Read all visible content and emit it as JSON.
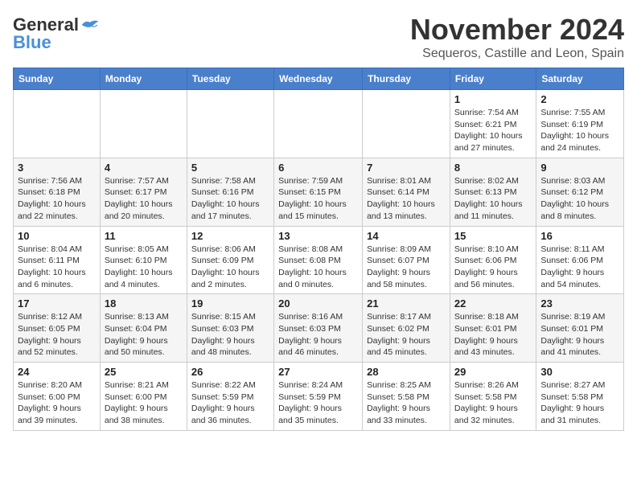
{
  "logo": {
    "general": "General",
    "blue": "Blue"
  },
  "title": "November 2024",
  "subtitle": "Sequeros, Castille and Leon, Spain",
  "days_of_week": [
    "Sunday",
    "Monday",
    "Tuesday",
    "Wednesday",
    "Thursday",
    "Friday",
    "Saturday"
  ],
  "weeks": [
    [
      {
        "day": "",
        "info": ""
      },
      {
        "day": "",
        "info": ""
      },
      {
        "day": "",
        "info": ""
      },
      {
        "day": "",
        "info": ""
      },
      {
        "day": "",
        "info": ""
      },
      {
        "day": "1",
        "info": "Sunrise: 7:54 AM\nSunset: 6:21 PM\nDaylight: 10 hours and 27 minutes."
      },
      {
        "day": "2",
        "info": "Sunrise: 7:55 AM\nSunset: 6:19 PM\nDaylight: 10 hours and 24 minutes."
      }
    ],
    [
      {
        "day": "3",
        "info": "Sunrise: 7:56 AM\nSunset: 6:18 PM\nDaylight: 10 hours and 22 minutes."
      },
      {
        "day": "4",
        "info": "Sunrise: 7:57 AM\nSunset: 6:17 PM\nDaylight: 10 hours and 20 minutes."
      },
      {
        "day": "5",
        "info": "Sunrise: 7:58 AM\nSunset: 6:16 PM\nDaylight: 10 hours and 17 minutes."
      },
      {
        "day": "6",
        "info": "Sunrise: 7:59 AM\nSunset: 6:15 PM\nDaylight: 10 hours and 15 minutes."
      },
      {
        "day": "7",
        "info": "Sunrise: 8:01 AM\nSunset: 6:14 PM\nDaylight: 10 hours and 13 minutes."
      },
      {
        "day": "8",
        "info": "Sunrise: 8:02 AM\nSunset: 6:13 PM\nDaylight: 10 hours and 11 minutes."
      },
      {
        "day": "9",
        "info": "Sunrise: 8:03 AM\nSunset: 6:12 PM\nDaylight: 10 hours and 8 minutes."
      }
    ],
    [
      {
        "day": "10",
        "info": "Sunrise: 8:04 AM\nSunset: 6:11 PM\nDaylight: 10 hours and 6 minutes."
      },
      {
        "day": "11",
        "info": "Sunrise: 8:05 AM\nSunset: 6:10 PM\nDaylight: 10 hours and 4 minutes."
      },
      {
        "day": "12",
        "info": "Sunrise: 8:06 AM\nSunset: 6:09 PM\nDaylight: 10 hours and 2 minutes."
      },
      {
        "day": "13",
        "info": "Sunrise: 8:08 AM\nSunset: 6:08 PM\nDaylight: 10 hours and 0 minutes."
      },
      {
        "day": "14",
        "info": "Sunrise: 8:09 AM\nSunset: 6:07 PM\nDaylight: 9 hours and 58 minutes."
      },
      {
        "day": "15",
        "info": "Sunrise: 8:10 AM\nSunset: 6:06 PM\nDaylight: 9 hours and 56 minutes."
      },
      {
        "day": "16",
        "info": "Sunrise: 8:11 AM\nSunset: 6:06 PM\nDaylight: 9 hours and 54 minutes."
      }
    ],
    [
      {
        "day": "17",
        "info": "Sunrise: 8:12 AM\nSunset: 6:05 PM\nDaylight: 9 hours and 52 minutes."
      },
      {
        "day": "18",
        "info": "Sunrise: 8:13 AM\nSunset: 6:04 PM\nDaylight: 9 hours and 50 minutes."
      },
      {
        "day": "19",
        "info": "Sunrise: 8:15 AM\nSunset: 6:03 PM\nDaylight: 9 hours and 48 minutes."
      },
      {
        "day": "20",
        "info": "Sunrise: 8:16 AM\nSunset: 6:03 PM\nDaylight: 9 hours and 46 minutes."
      },
      {
        "day": "21",
        "info": "Sunrise: 8:17 AM\nSunset: 6:02 PM\nDaylight: 9 hours and 45 minutes."
      },
      {
        "day": "22",
        "info": "Sunrise: 8:18 AM\nSunset: 6:01 PM\nDaylight: 9 hours and 43 minutes."
      },
      {
        "day": "23",
        "info": "Sunrise: 8:19 AM\nSunset: 6:01 PM\nDaylight: 9 hours and 41 minutes."
      }
    ],
    [
      {
        "day": "24",
        "info": "Sunrise: 8:20 AM\nSunset: 6:00 PM\nDaylight: 9 hours and 39 minutes."
      },
      {
        "day": "25",
        "info": "Sunrise: 8:21 AM\nSunset: 6:00 PM\nDaylight: 9 hours and 38 minutes."
      },
      {
        "day": "26",
        "info": "Sunrise: 8:22 AM\nSunset: 5:59 PM\nDaylight: 9 hours and 36 minutes."
      },
      {
        "day": "27",
        "info": "Sunrise: 8:24 AM\nSunset: 5:59 PM\nDaylight: 9 hours and 35 minutes."
      },
      {
        "day": "28",
        "info": "Sunrise: 8:25 AM\nSunset: 5:58 PM\nDaylight: 9 hours and 33 minutes."
      },
      {
        "day": "29",
        "info": "Sunrise: 8:26 AM\nSunset: 5:58 PM\nDaylight: 9 hours and 32 minutes."
      },
      {
        "day": "30",
        "info": "Sunrise: 8:27 AM\nSunset: 5:58 PM\nDaylight: 9 hours and 31 minutes."
      }
    ]
  ]
}
